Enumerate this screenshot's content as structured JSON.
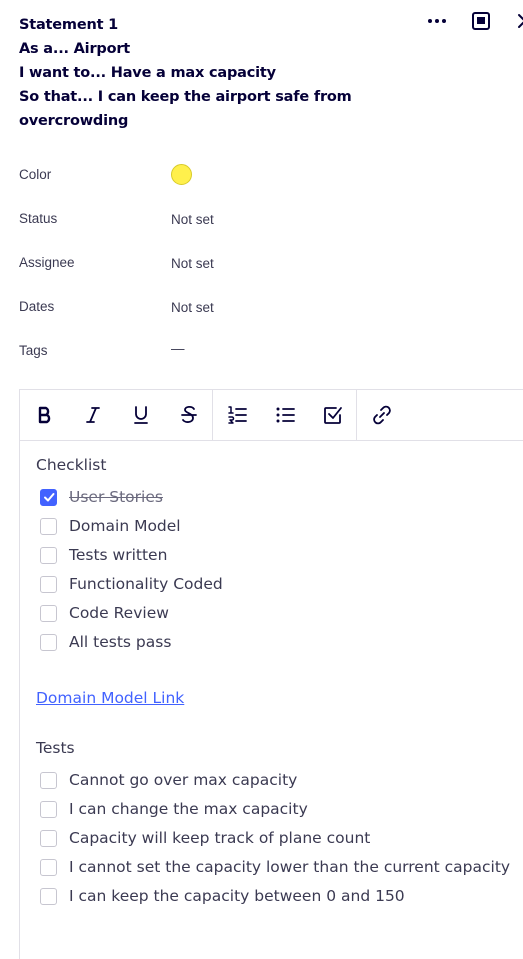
{
  "card": {
    "title_lines": [
      "Statement 1",
      "As a... Airport",
      "I want to... Have a max capacity",
      "So that... I can keep the airport safe from",
      "overcrowding"
    ],
    "actions": {
      "more_icon": "more-horizontal-icon",
      "expand_icon": "expand-panel-icon",
      "close_icon": "close-icon"
    }
  },
  "meta": {
    "color": {
      "label": "Color",
      "value_color": "#fff04c"
    },
    "status": {
      "label": "Status",
      "value": "Not set"
    },
    "assignee": {
      "label": "Assignee",
      "value": "Not set"
    },
    "dates": {
      "label": "Dates",
      "value": "Not set"
    },
    "tags": {
      "label": "Tags",
      "value": "—"
    }
  },
  "toolbar": {
    "tools": [
      "bold-icon",
      "italic-icon",
      "underline-icon",
      "strikethrough-icon",
      "numbered-list-icon",
      "bullet-list-icon",
      "checklist-icon",
      "link-icon"
    ]
  },
  "checklist": {
    "heading": "Checklist",
    "items": [
      {
        "label": "User Stories",
        "checked": true
      },
      {
        "label": "Domain Model",
        "checked": false
      },
      {
        "label": "Tests written",
        "checked": false
      },
      {
        "label": "Functionality Coded",
        "checked": false
      },
      {
        "label": "Code Review",
        "checked": false
      },
      {
        "label": "All tests pass",
        "checked": false
      }
    ]
  },
  "link": {
    "label": "Domain Model Link"
  },
  "tests": {
    "heading": "Tests",
    "items": [
      {
        "label": "Cannot go over max capacity",
        "checked": false
      },
      {
        "label": "I can change the max capacity",
        "checked": false
      },
      {
        "label": "Capacity will keep track of plane count",
        "checked": false
      },
      {
        "label": "I cannot set the capacity lower than the current capacity",
        "checked": false
      },
      {
        "label": "I can keep the capacity between 0 and 150",
        "checked": false
      }
    ]
  },
  "colors": {
    "accent": "#4262ff",
    "text": "#050038",
    "muted": "#3b3a52",
    "border": "#e1e0e7"
  }
}
